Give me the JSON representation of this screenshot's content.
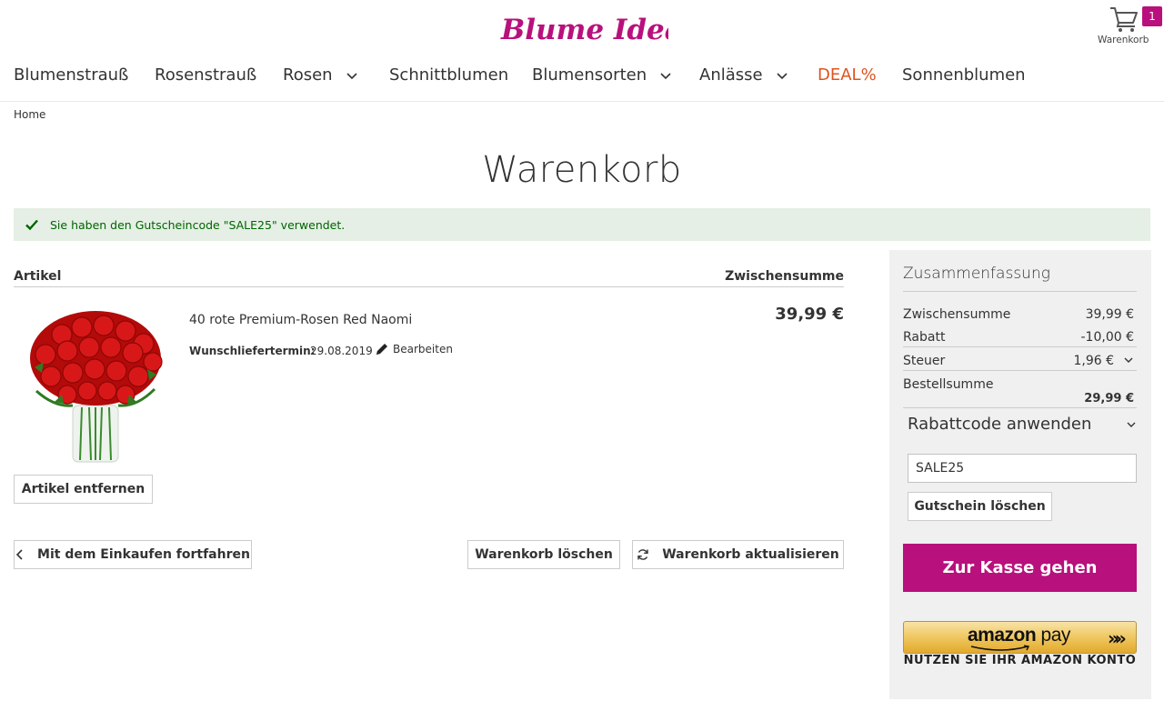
{
  "brand": {
    "logo_text": "Blume Ideal",
    "accent": "#b8107c"
  },
  "header": {
    "cart": {
      "label": "Warenkorb",
      "count": "1",
      "icon": "cart-icon"
    }
  },
  "nav": {
    "items": [
      {
        "label": "Blumenstrauß"
      },
      {
        "label": "Rosenstrauß"
      },
      {
        "label": "Rosen",
        "dropdown": true
      },
      {
        "label": "Schnittblumen"
      },
      {
        "label": "Blumensorten",
        "dropdown": true
      },
      {
        "label": "Anlässe",
        "dropdown": true
      },
      {
        "label": "DEAL%",
        "highlight_color": "#e0531f"
      },
      {
        "label": "Sonnenblumen"
      }
    ]
  },
  "breadcrumb": {
    "home": "Home"
  },
  "page": {
    "title": "Warenkorb"
  },
  "message": {
    "text": "Sie haben den Gutscheincode \"SALE25\" verwendet.",
    "icon": "checkmark-icon",
    "color": "#006400"
  },
  "cart_table": {
    "header_article": "Artikel",
    "header_subtotal": "Zwischensumme",
    "item": {
      "name": "40 rote Premium-Rosen Red Naomi",
      "delivery_label": "Wunschliefertermin:",
      "delivery_date": "29.08.2019",
      "edit_label": "Bearbeiten",
      "price": "39,99 €",
      "remove_label": "Artikel entfernen"
    }
  },
  "actions": {
    "continue_label": "Mit dem Einkaufen fortfahren",
    "clear_label": "Warenkorb löschen",
    "update_label": "Warenkorb aktualisieren"
  },
  "summary": {
    "title": "Zusammenfassung",
    "subtotal_label": "Zwischensumme",
    "subtotal_value": "39,99 €",
    "discount_label": "Rabatt",
    "discount_value": "-10,00 €",
    "tax_label": "Steuer",
    "tax_value": "1,96 €",
    "total_label": "Bestellsumme",
    "total_value": "29,99 €",
    "coupon_heading": "Rabattcode anwenden",
    "coupon_value": "SALE25",
    "coupon_remove_label": "Gutschein löschen",
    "checkout_label": "Zur Kasse gehen"
  },
  "amazon_pay": {
    "logo_a": "amazon",
    "logo_b": " pay",
    "arrows": "»",
    "subtitle": "NUTZEN SIE IHR AMAZON KONTO"
  }
}
